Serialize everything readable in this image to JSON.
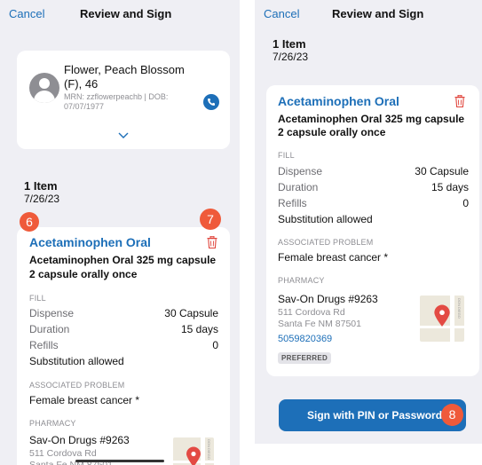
{
  "nav": {
    "cancel_label": "Cancel",
    "title": "Review and Sign"
  },
  "patient": {
    "name_line": "Flower, Peach Blossom",
    "sex_age": "(F), 46",
    "mrn_dob_line1": "MRN: zzflowerpeachb | DOB:",
    "mrn_dob_line2": "07/07/1977",
    "icons": {
      "avatar": "person-avatar-icon",
      "phone": "phone-icon",
      "expand": "chevron-down-icon"
    }
  },
  "order_summary": {
    "item_count": "1 Item",
    "date": "7/26/23"
  },
  "medication": {
    "name": "Acetaminophen Oral",
    "description_line1": "Acetaminophen Oral 325 mg capsule",
    "description_line2": "2 capsule orally once",
    "fill_label": "FILL",
    "dispense_label": "Dispense",
    "dispense_value": "30 Capsule",
    "duration_label": "Duration",
    "duration_value": "15 days",
    "refills_label": "Refills",
    "refills_value": "0",
    "substitution": "Substitution allowed",
    "problem_label": "ASSOCIATED PROBLEM",
    "problem": "Female breast cancer *",
    "pharmacy_label": "PHARMACY",
    "delete_icon": "trash-icon"
  },
  "pharmacy": {
    "name": "Sav-On Drugs #9263",
    "address_line1": "511 Cordova Rd",
    "address_line2": "Santa Fe NM 87501",
    "phone": "5059820369",
    "preferred_badge": "PREFERRED",
    "map_road_label": "DON DIEGO"
  },
  "actions": {
    "sign_label": "Sign with PIN or Password"
  },
  "annotations": {
    "step6": "6",
    "step7": "7",
    "step8": "8"
  },
  "colors": {
    "accent": "#1d6fb8",
    "badge": "#ef5a3a",
    "delete": "#e0433a",
    "background": "#efeff4"
  }
}
